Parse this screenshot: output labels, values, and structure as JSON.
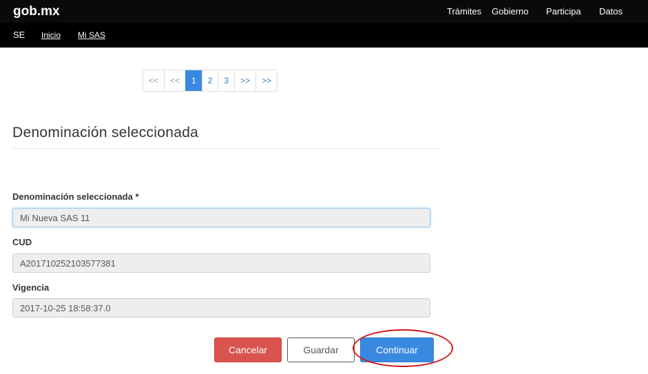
{
  "header": {
    "brand": "gob.mx",
    "nav": [
      "Trámites",
      "Gobierno",
      "Participa",
      "Datos"
    ]
  },
  "subheader": {
    "section": "SE",
    "links": [
      "Inicio",
      "Mi SAS"
    ]
  },
  "pagination": {
    "first": "<<",
    "prev": "<<",
    "pages": [
      "1",
      "2",
      "3"
    ],
    "active_page": "1",
    "next": ">>",
    "last": ">>"
  },
  "form": {
    "title": "Denominación seleccionada",
    "fields": [
      {
        "label": "Denominación seleccionada *",
        "value": "Mi Nueva SAS 11"
      },
      {
        "label": "CUD",
        "value": "A201710252103577381"
      },
      {
        "label": "Vigencia",
        "value": "2017-10-25 18:58:37.0"
      }
    ]
  },
  "actions": {
    "cancel": "Cancelar",
    "save": "Guardar",
    "continue": "Continuar"
  },
  "colors": {
    "header_bg": "#0a0a0a",
    "primary": "#3a89e0",
    "danger": "#d9534f",
    "annotation": "#d0161b"
  }
}
